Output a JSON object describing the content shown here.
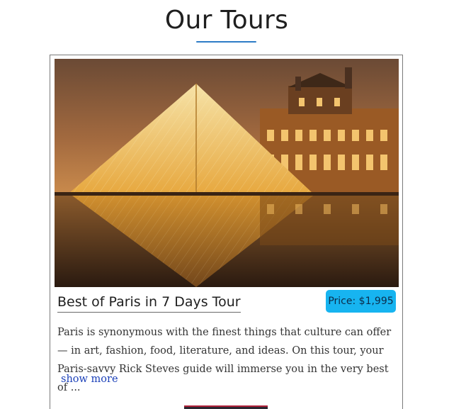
{
  "section": {
    "heading": "Our Tours",
    "accent_color": "#2e7cc6"
  },
  "tour_card": {
    "image_alt": "Louvre pyramid at night",
    "title": "Best of Paris in 7 Days Tour",
    "price": "Price: $1,995",
    "price_badge_color": "#17b4f0",
    "description": "Paris is synonymous with the finest things that culture can offer — in art, fashion, food, literature, and ideas. On this tour, your Paris-savvy Rick Steves guide will immerse you in the very best of ...",
    "show_more_label": "show more",
    "link_color": "#1a3fb8"
  }
}
